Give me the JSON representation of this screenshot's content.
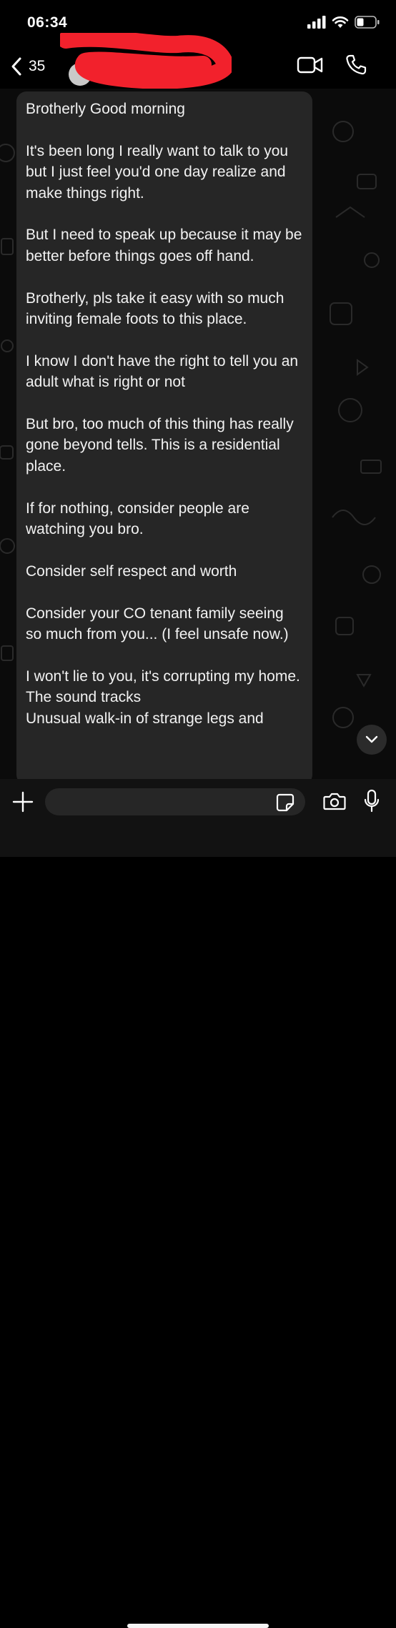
{
  "status_bar": {
    "time": "06:34",
    "icons": [
      "signal-icon",
      "wifi-icon",
      "battery-icon"
    ]
  },
  "header": {
    "back_count": "35",
    "icons": {
      "back": "chevron-left-icon",
      "video": "video-icon",
      "call": "phone-icon"
    }
  },
  "message": {
    "paragraphs": [
      "Brotherly Good morning",
      "It's been long I really want to talk to you but I just feel you'd one day realize and make things right.",
      "But I need to speak up because it may be better before things goes off hand.",
      "Brotherly, pls take it easy with so much inviting female foots to this place.",
      "I know I don't have the right to tell you an adult what is right or not",
      "But bro, too much of this thing has really gone beyond tells. This is a residential place.",
      "If for nothing, consider people are watching you bro.",
      "Consider self respect and worth",
      "Consider your CO tenant family seeing so much from you... (I feel unsafe now.)",
      "I won't lie to you, it's corrupting my home.\nThe sound tracks\nUnusual walk-in of strange legs and"
    ]
  },
  "composer": {
    "placeholder": "",
    "icons": {
      "plus": "plus-icon",
      "sticker": "sticker-icon",
      "camera": "camera-icon",
      "mic": "microphone-icon",
      "scroll": "chevron-down-icon"
    }
  },
  "colors": {
    "background": "#000000",
    "bubble": "#262626",
    "redaction": "#f2212c"
  }
}
